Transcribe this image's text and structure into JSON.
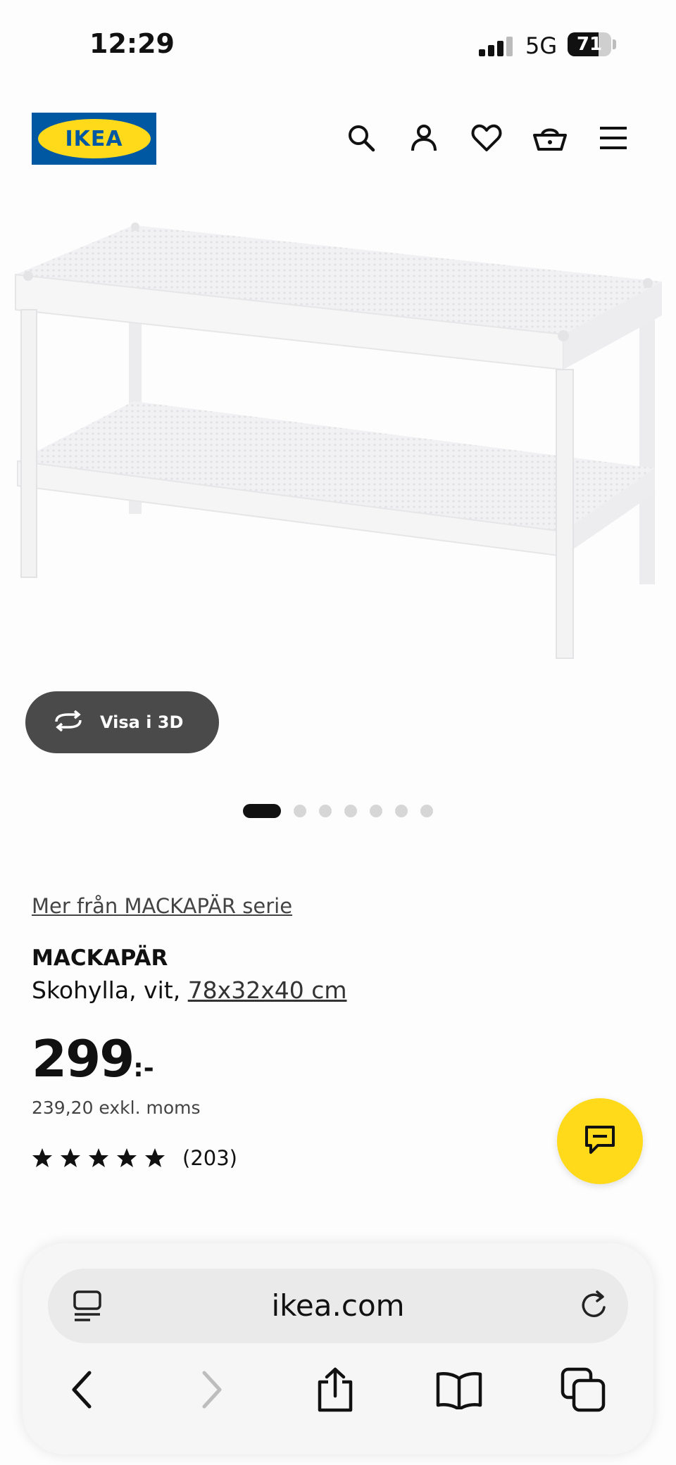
{
  "status_bar": {
    "time": "12:29",
    "network": "5G",
    "battery": "71",
    "battery_level": 0.71
  },
  "header": {
    "logo_text": "IKEA",
    "icons": [
      "search-icon",
      "user-icon",
      "heart-icon",
      "basket-icon",
      "menu-icon"
    ]
  },
  "product": {
    "view_3d_label": "Visa i 3D",
    "carousel": {
      "count": 7,
      "active": 0
    },
    "series_link": "Mer från MACKAPÄR serie",
    "name": "MACKAPÄR",
    "description_prefix": "Skohylla, vit,",
    "dimensions": "78x32x40 cm",
    "price": "299",
    "price_suffix": ":-",
    "price_excl": "239,20 exkl. moms",
    "rating_stars": 5,
    "rating_count": "(203)"
  },
  "browser": {
    "url": "ikea.com",
    "nav_icons": [
      "back-icon",
      "forward-icon",
      "share-icon",
      "bookmarks-icon",
      "tabs-icon"
    ]
  },
  "colors": {
    "ikea_blue": "#0058a3",
    "ikea_yellow": "#ffda1a",
    "button_dark": "#4a4a4a"
  }
}
